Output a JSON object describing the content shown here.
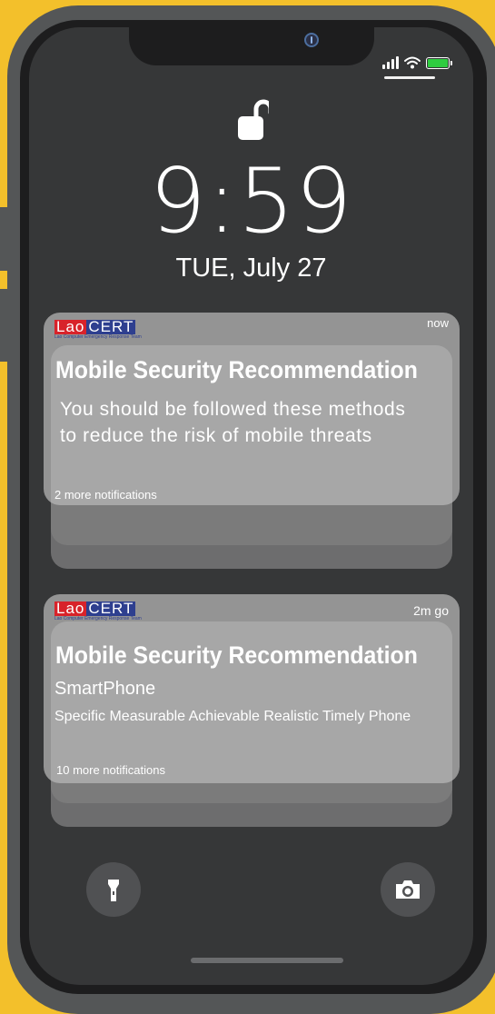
{
  "lock_screen": {
    "time": "9:59",
    "date": "TUE, July 27"
  },
  "notifications": [
    {
      "app_name_red": "Lao",
      "app_name_blue": "CERT",
      "app_tagline": "Lao Computer Emergency Response Team",
      "timestamp": "now",
      "title": "Mobile Security Recommendation",
      "body_line1": "You should be followed these methods",
      "body_line2": "to reduce the risk of mobile threats",
      "more": "2 more notifications"
    },
    {
      "app_name_red": "Lao",
      "app_name_blue": "CERT",
      "app_tagline": "Lao Computer Emergency Response Team",
      "timestamp": "2m go",
      "title": "Mobile Security Recommendation",
      "subtitle": "SmartPhone",
      "body": "Specific Measurable Achievable Realistic Timely Phone",
      "more": "10 more notifications"
    }
  ],
  "status": {
    "battery_level": 1.0,
    "battery_color": "#2ecc40"
  },
  "colors": {
    "background": "#f3c02b",
    "phone_frame": "#545657",
    "screen": "#363738"
  },
  "icons": [
    "unlocked-padlock-icon",
    "signal-icon",
    "wifi-icon",
    "battery-icon",
    "flashlight-icon",
    "camera-icon"
  ]
}
